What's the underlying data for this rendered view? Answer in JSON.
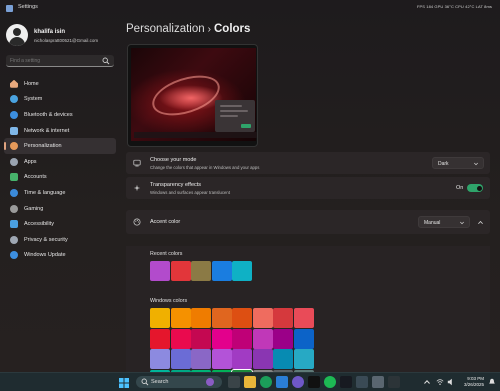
{
  "window": {
    "title": "Settings"
  },
  "overlay": {
    "stats": "FPS 184  GPU 36°C  CPU 42°C  LAT 8ms"
  },
  "profile": {
    "name": "khalifa isin",
    "email": "nicholaspratt00521@Gmail.com"
  },
  "search": {
    "placeholder": "Find a setting"
  },
  "nav": [
    {
      "label": "Home",
      "icon": "home-icon",
      "color": "#e7a87d"
    },
    {
      "label": "System",
      "icon": "system-icon",
      "color": "#4aa3e0"
    },
    {
      "label": "Bluetooth & devices",
      "icon": "bluetooth-icon",
      "color": "#3c8fe0"
    },
    {
      "label": "Network & internet",
      "icon": "network-icon",
      "color": "#7fb7e8"
    },
    {
      "label": "Personalization",
      "icon": "brush-icon",
      "color": "#e69a5a",
      "active": true
    },
    {
      "label": "Apps",
      "icon": "apps-icon",
      "color": "#9aa4b1"
    },
    {
      "label": "Accounts",
      "icon": "accounts-icon",
      "color": "#47b36b"
    },
    {
      "label": "Time & language",
      "icon": "clock-icon",
      "color": "#3b8ad9"
    },
    {
      "label": "Gaming",
      "icon": "gaming-icon",
      "color": "#9a9a9a"
    },
    {
      "label": "Accessibility",
      "icon": "accessibility-icon",
      "color": "#4a9fe0"
    },
    {
      "label": "Privacy & security",
      "icon": "shield-icon",
      "color": "#9ea7b3"
    },
    {
      "label": "Windows Update",
      "icon": "update-icon",
      "color": "#3d8fe0"
    }
  ],
  "breadcrumb": {
    "parent": "Personalization",
    "separator": "›",
    "current": "Colors"
  },
  "mode": {
    "title": "Choose your mode",
    "subtitle": "Change the colors that appear in Windows and your apps",
    "value": "Dark"
  },
  "transparency": {
    "title": "Transparency effects",
    "subtitle": "Windows and surfaces appear translucent",
    "state": "On",
    "on": true
  },
  "accent": {
    "title": "Accent color",
    "value": "Manual"
  },
  "recent_colors": {
    "label": "Recent colors",
    "swatches": [
      "#b24bcc",
      "#e2363a",
      "#8b7a45",
      "#1a7de0",
      "#0fb1c5"
    ]
  },
  "windows_colors": {
    "label": "Windows colors",
    "rows": [
      [
        "#f0b000",
        "#f59100",
        "#ef7c00",
        "#e0661f",
        "#dd4f12",
        "#ef6c5f",
        "#d5393d",
        "#e94b58"
      ],
      [
        "#e5162c",
        "#ea0a4e",
        "#c40851",
        "#e3008c",
        "#bf0077",
        "#c038b8",
        "#9b0088",
        "#0c63c8"
      ],
      [
        "#8c8ae0",
        "#6b6cd6",
        "#8a67c6",
        "#b353d8",
        "#a13bc3",
        "#8a36b2",
        "#078bb2",
        "#27a9c4"
      ],
      [
        "#00b59a",
        "#00a884",
        "#00b276",
        "#02b058",
        "#1c8a3c",
        "#848484",
        "#5d6367",
        "#5f7a78"
      ]
    ],
    "selected": {
      "row": 3,
      "col": 4
    }
  },
  "taskbar": {
    "search_label": "Search",
    "time": "9:03 PM",
    "date": "3/26/2025"
  }
}
